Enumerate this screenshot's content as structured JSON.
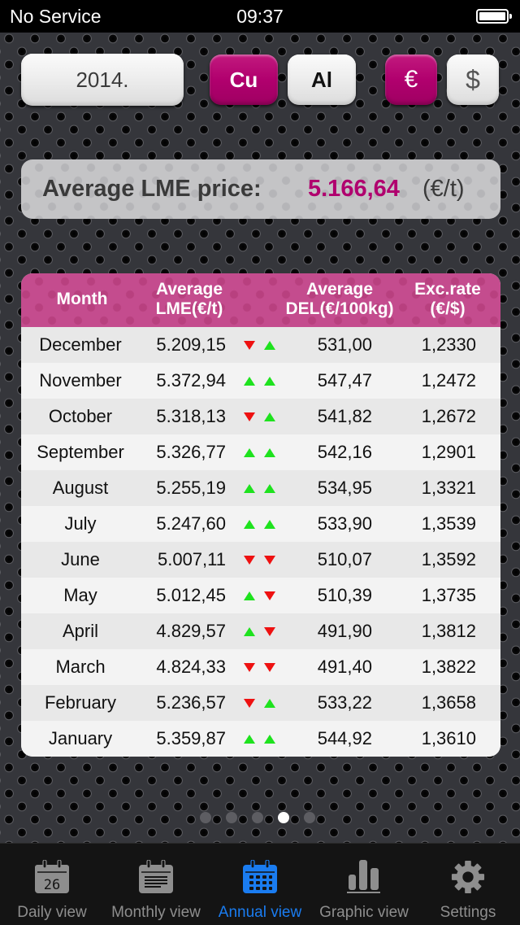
{
  "status_bar": {
    "carrier": "No Service",
    "time": "09:37",
    "battery_icon": "battery-full-icon"
  },
  "toolbar": {
    "year": "2014.",
    "metals": [
      {
        "label": "Cu",
        "selected": true
      },
      {
        "label": "Al",
        "selected": false
      }
    ],
    "currencies": [
      {
        "label": "€",
        "selected": true
      },
      {
        "label": "$",
        "selected": false
      }
    ]
  },
  "summary": {
    "label": "Average LME price:",
    "value": "5.166,64",
    "unit": "(€/t)"
  },
  "table": {
    "headers": {
      "month": "Month",
      "lme": [
        "Average",
        "LME(€/t)"
      ],
      "del": [
        "Average",
        "DEL(€/100kg)"
      ],
      "exc": [
        "Exc.rate",
        "(€/$)"
      ]
    },
    "rows": [
      {
        "month": "December",
        "lme": "5.209,15",
        "trend1": "down",
        "trend2": "up",
        "del": "531,00",
        "exc": "1,2330"
      },
      {
        "month": "November",
        "lme": "5.372,94",
        "trend1": "up",
        "trend2": "up",
        "del": "547,47",
        "exc": "1,2472"
      },
      {
        "month": "October",
        "lme": "5.318,13",
        "trend1": "down",
        "trend2": "up",
        "del": "541,82",
        "exc": "1,2672"
      },
      {
        "month": "September",
        "lme": "5.326,77",
        "trend1": "up",
        "trend2": "up",
        "del": "542,16",
        "exc": "1,2901"
      },
      {
        "month": "August",
        "lme": "5.255,19",
        "trend1": "up",
        "trend2": "up",
        "del": "534,95",
        "exc": "1,3321"
      },
      {
        "month": "July",
        "lme": "5.247,60",
        "trend1": "up",
        "trend2": "up",
        "del": "533,90",
        "exc": "1,3539"
      },
      {
        "month": "June",
        "lme": "5.007,11",
        "trend1": "down",
        "trend2": "down",
        "del": "510,07",
        "exc": "1,3592"
      },
      {
        "month": "May",
        "lme": "5.012,45",
        "trend1": "up",
        "trend2": "down",
        "del": "510,39",
        "exc": "1,3735"
      },
      {
        "month": "April",
        "lme": "4.829,57",
        "trend1": "up",
        "trend2": "down",
        "del": "491,90",
        "exc": "1,3812"
      },
      {
        "month": "March",
        "lme": "4.824,33",
        "trend1": "down",
        "trend2": "down",
        "del": "491,40",
        "exc": "1,3822"
      },
      {
        "month": "February",
        "lme": "5.236,57",
        "trend1": "down",
        "trend2": "up",
        "del": "533,22",
        "exc": "1,3658"
      },
      {
        "month": "January",
        "lme": "5.359,87",
        "trend1": "up",
        "trend2": "up",
        "del": "544,92",
        "exc": "1,3610"
      }
    ]
  },
  "pager": {
    "pages": 5,
    "current": 4
  },
  "tabbar": {
    "tabs": [
      {
        "label": "Daily view",
        "icon": "calendar-day-icon",
        "icon_text": "26",
        "active": false
      },
      {
        "label": "Monthly view",
        "icon": "calendar-month-icon",
        "active": false
      },
      {
        "label": "Annual view",
        "icon": "calendar-year-icon",
        "active": true
      },
      {
        "label": "Graphic view",
        "icon": "bar-chart-icon",
        "active": false
      },
      {
        "label": "Settings",
        "icon": "gear-icon",
        "active": false
      }
    ],
    "active_color": "#1a7cf0",
    "inactive_color": "#8e8e8e"
  },
  "colors": {
    "accent": "#b0006e",
    "up": "#1ee21e",
    "down": "#ee1111"
  }
}
